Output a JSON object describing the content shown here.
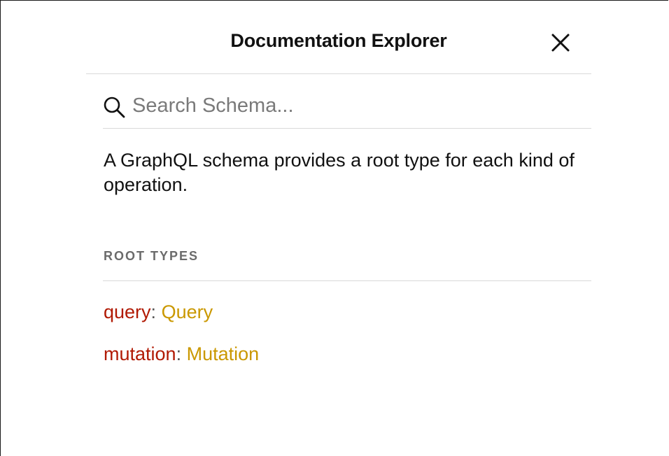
{
  "header": {
    "title": "Documentation Explorer",
    "close_icon": "close-icon"
  },
  "search": {
    "icon": "search-icon",
    "placeholder": "Search Schema...",
    "value": ""
  },
  "description": "A GraphQL schema provides a root type for each kind of operation.",
  "root_types": {
    "heading": "ROOT TYPES",
    "items": [
      {
        "field": "query",
        "separator": ": ",
        "type": "Query"
      },
      {
        "field": "mutation",
        "separator": ": ",
        "type": "Mutation"
      }
    ]
  },
  "colors": {
    "field": "#b11a04",
    "type": "#ca9800",
    "section_heading": "#6b6b6b",
    "divider": "#d9d9d9"
  }
}
